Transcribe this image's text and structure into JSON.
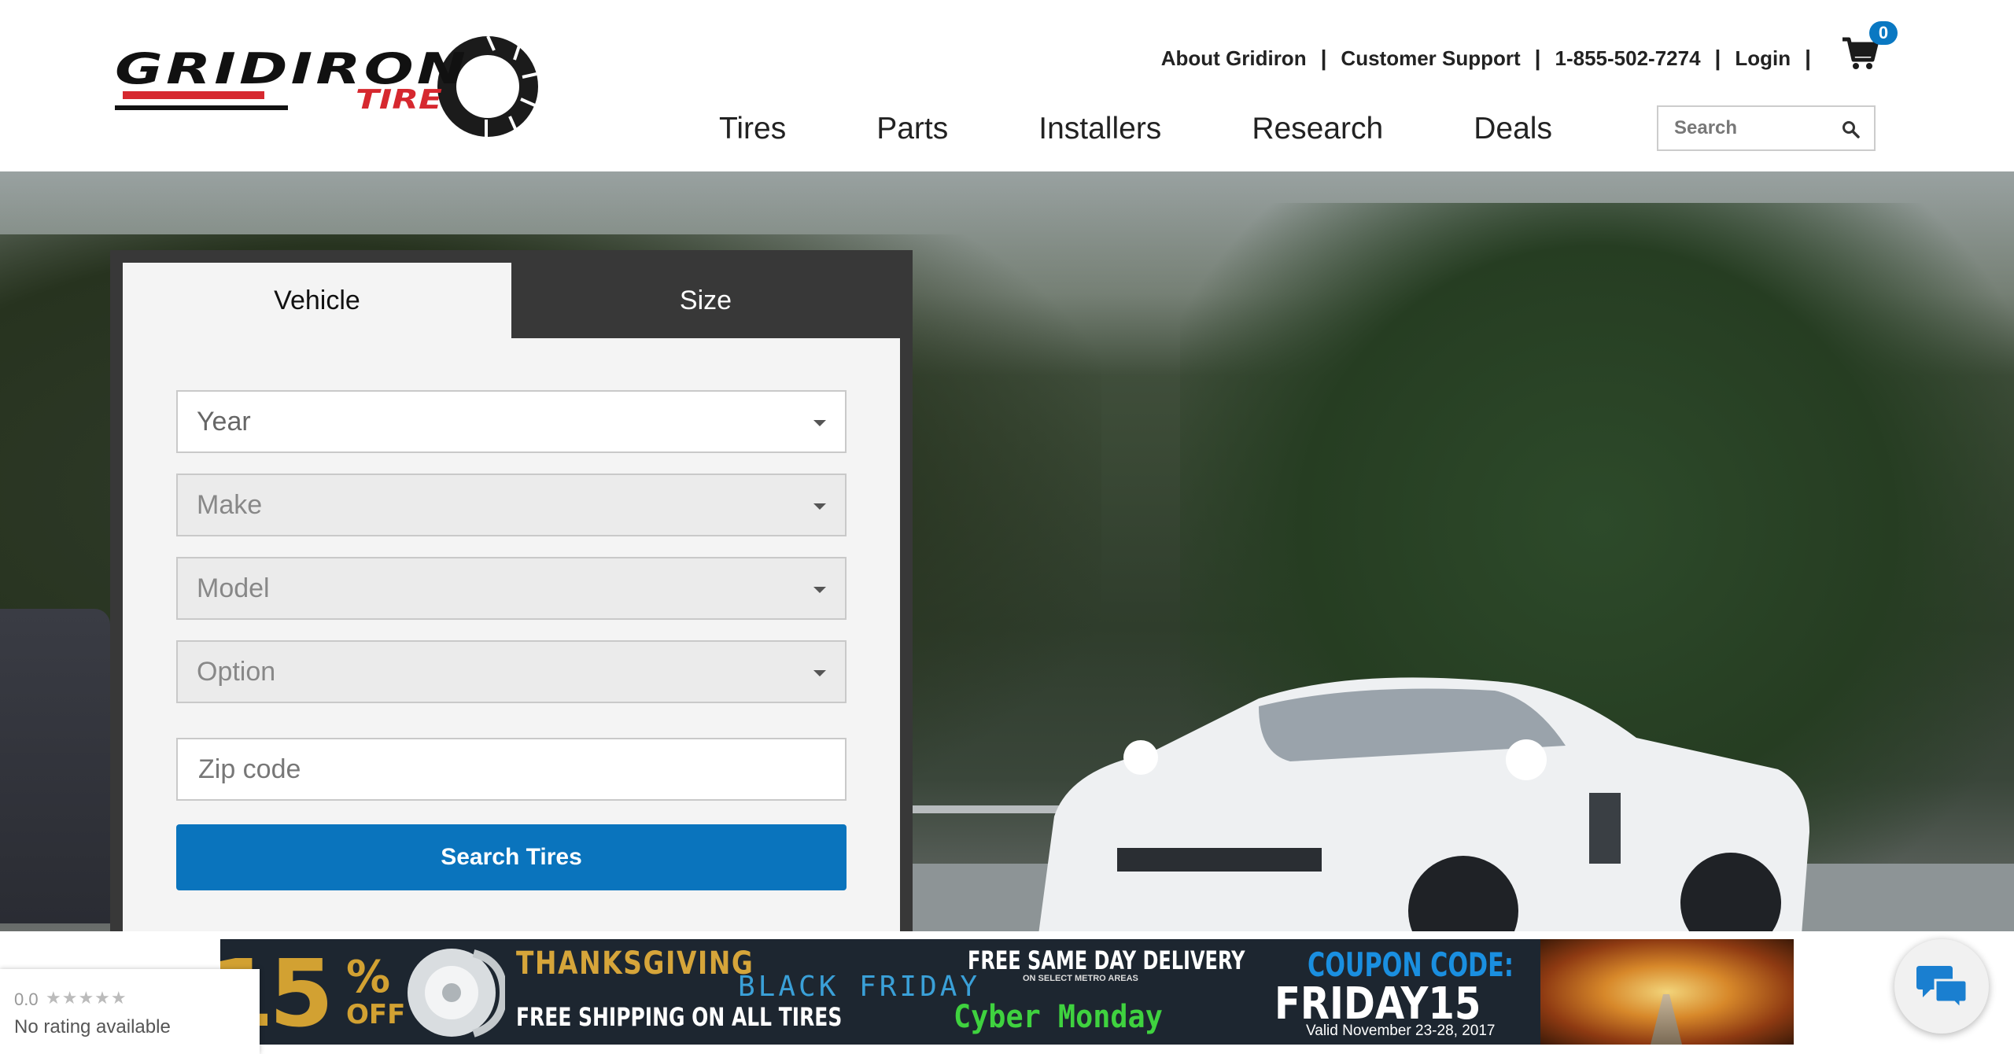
{
  "brand": {
    "logo_text": "GRIDIRON",
    "logo_subtext": "TIRE",
    "colors": {
      "accent": "#0a74bd",
      "logo_red": "#d6282f",
      "panel_dark": "#383838"
    }
  },
  "top_links": {
    "about": "About Gridiron",
    "support": "Customer Support",
    "phone": "1-855-502-7274",
    "login": "Login",
    "separator": "|"
  },
  "cart": {
    "icon": "cart-icon",
    "count": "0"
  },
  "nav": [
    "Tires",
    "Parts",
    "Installers",
    "Research",
    "Deals"
  ],
  "search": {
    "placeholder": "Search",
    "icon": "search-icon"
  },
  "finder": {
    "tabs": {
      "vehicle": "Vehicle",
      "size": "Size",
      "active": "Vehicle"
    },
    "year": "Year",
    "make": "Make",
    "model": "Model",
    "option": "Option",
    "zip_placeholder": "Zip code",
    "submit": "Search Tires"
  },
  "promo": {
    "percent": "15",
    "percent_symbol": "%",
    "off": "OFF",
    "thanksgiving": "THANKSGIVING",
    "black_friday": "BLACK FRIDAY",
    "free_shipping": "FREE SHIPPING ON ALL TIRES",
    "same_day": "FREE SAME DAY DELIVERY",
    "metro": "ON SELECT METRO AREAS",
    "cyber_monday": "Cyber Monday",
    "coupon_title": "COUPON CODE:",
    "coupon_code": "FRIDAY15",
    "valid": "Valid November 23-28, 2017"
  },
  "rating": {
    "score": "0.0",
    "stars": "★★★★★",
    "label": "No rating available"
  },
  "chat": {
    "icon": "chat-bubbles-icon"
  }
}
